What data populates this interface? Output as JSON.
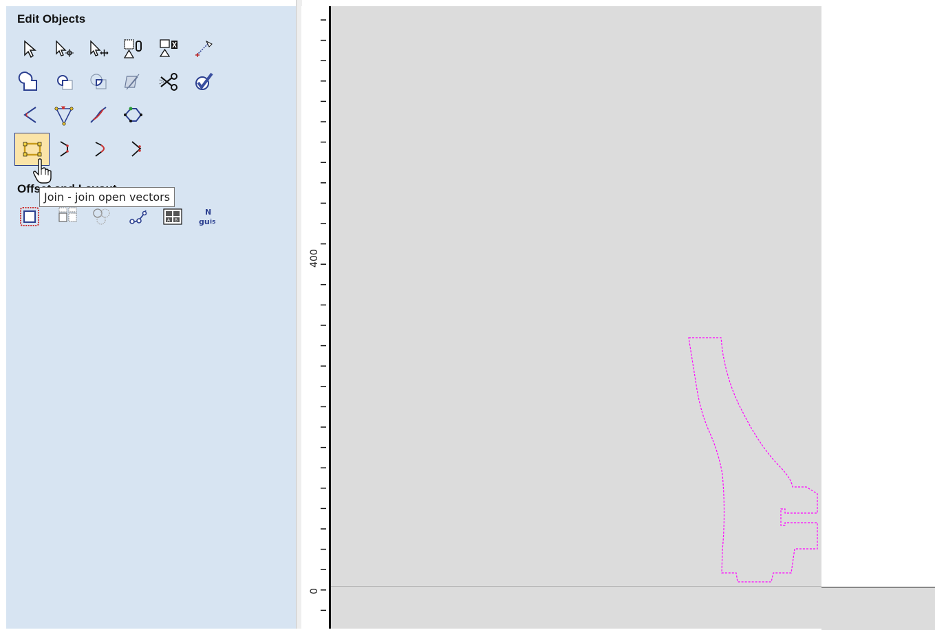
{
  "panel": {
    "edit_objects_title": "Edit Objects",
    "offset_layout_title": "Offset and Layout",
    "tooltip": "Join - join open vectors",
    "edit_tools": [
      {
        "name": "select-icon"
      },
      {
        "name": "node-edit-icon"
      },
      {
        "name": "transform-icon"
      },
      {
        "name": "group-icon"
      },
      {
        "name": "ungroup-icon"
      },
      {
        "name": "measure-icon"
      },
      {
        "name": "weld-icon"
      },
      {
        "name": "subtract-icon"
      },
      {
        "name": "intersect-icon"
      },
      {
        "name": "trim-icon"
      },
      {
        "name": "scissors-icon"
      },
      {
        "name": "validate-icon"
      },
      {
        "name": "fillet-icon"
      },
      {
        "name": "node-polygon-icon"
      },
      {
        "name": "smooth-curve-icon"
      },
      {
        "name": "close-vector-icon"
      },
      {
        "name": "join-icon",
        "active": true
      },
      {
        "name": "join-line-icon"
      },
      {
        "name": "join-curve-icon"
      },
      {
        "name": "join-node-icon"
      }
    ],
    "offset_tools": [
      {
        "name": "offset-icon"
      },
      {
        "name": "array-copy-icon"
      },
      {
        "name": "circular-array-icon"
      },
      {
        "name": "copy-along-vector-icon"
      },
      {
        "name": "fit-objects-icon"
      },
      {
        "name": "nesting-icon"
      }
    ]
  },
  "ruler": {
    "labels": [
      "400",
      "0"
    ]
  },
  "colors": {
    "panel_bg": "#d7e4f2",
    "canvas_bg": "#dcdcdc",
    "vector_selected": "#ff00ff",
    "active_button_bg": "#fbe4a8"
  }
}
